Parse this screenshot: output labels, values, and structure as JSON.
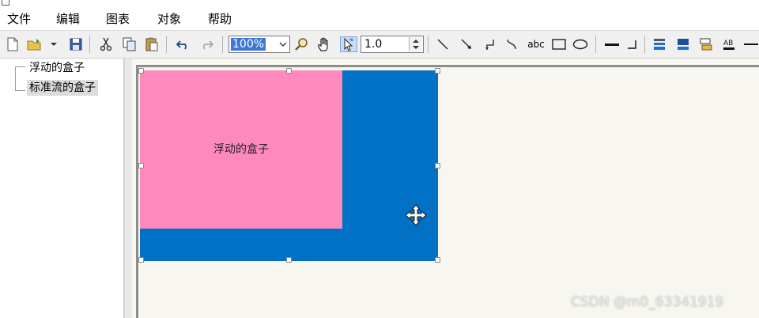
{
  "menu": {
    "items": [
      "文件",
      "编辑",
      "图表",
      "对象",
      "帮助"
    ]
  },
  "toolbar": {
    "zoom_value": "100%",
    "line_width_value": "1.0",
    "text_tool_label": "abc",
    "icons": [
      "new-file-icon",
      "open-folder-icon",
      "dropdown-arrow-icon",
      "save-icon",
      "cut-icon",
      "copy-icon",
      "paste-icon",
      "undo-icon",
      "redo-icon",
      "zoom-icon",
      "hand-icon",
      "pointer-icon",
      "line-icon",
      "arrow-line-icon",
      "elbow-connector-icon",
      "curved-connector-icon",
      "text-tool-icon",
      "rectangle-icon",
      "ellipse-icon",
      "line-style-icon",
      "corner-line-icon",
      "fill-color-icon",
      "line-color-icon",
      "shadow-icon",
      "font-color-icon",
      "dash-icon"
    ]
  },
  "tree": {
    "items": [
      {
        "label": "浮动的盒子",
        "selected": false
      },
      {
        "label": "标准流的盒子",
        "selected": true
      }
    ]
  },
  "canvas": {
    "pink_box_label": "浮动的盒子",
    "blue_box_color": "#0071c5",
    "pink_box_color": "#ff89bd"
  },
  "watermark": "CSDN @m0_63341919"
}
